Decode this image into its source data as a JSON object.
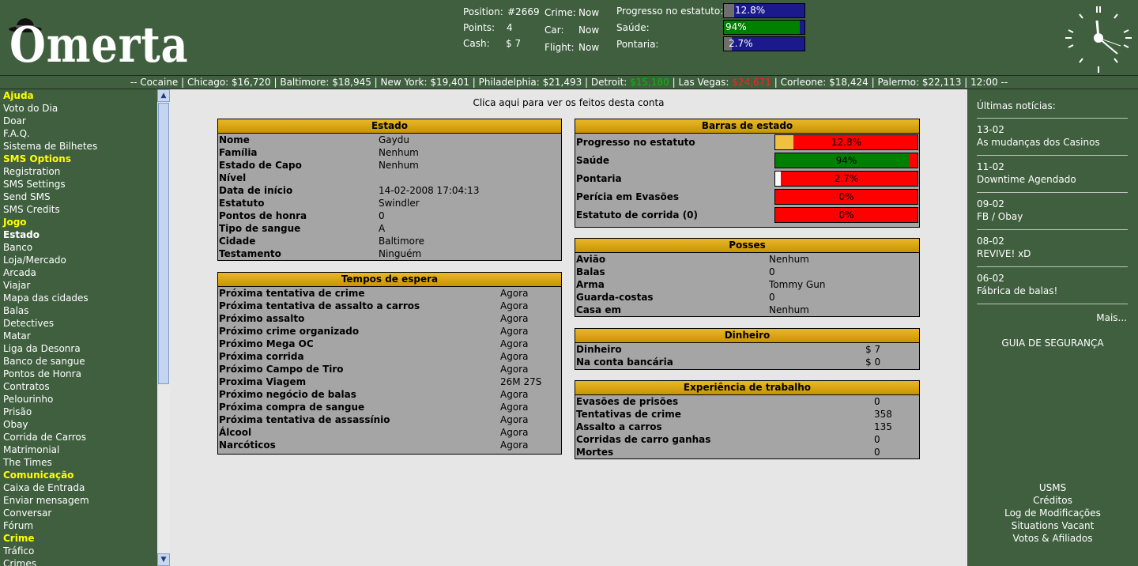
{
  "header": {
    "logo_text": "Omerta",
    "position_label": "Position:",
    "position_value": "#2669",
    "points_label": "Points:",
    "points_value": "4",
    "cash_label": "Cash:",
    "cash_value": "$ 7",
    "crime_label": "Crime:",
    "crime_value": "Now",
    "car_label": "Car:",
    "car_value": "Now",
    "flight_label": "Flight:",
    "flight_value": "Now",
    "progress_label": "Progresso no estatuto:",
    "progress_text": "12.8%",
    "progress_fraction": 0.128,
    "health_label": "Saúde:",
    "health_text": "94%",
    "health_fraction": 0.94,
    "aim_label": "Pontaria:",
    "aim_text": "2.7%",
    "aim_fraction": 0.027,
    "clock_icon": "clock-icon"
  },
  "ticker": {
    "prefix": "-- Cocaine | Chicago: $16,720 | Baltimore: $18,945 | New York: $19,401 | Philadelphia: $21,493 | Detroit: ",
    "detroit": "$15,180",
    "middle": " | Las Vegas: ",
    "vegas": "$24,671",
    "suffix": " | Corleone: $18,424 | Palermo: $22,113 | 12:00 --"
  },
  "sidebar": {
    "items": [
      {
        "label": "Ajuda",
        "type": "cat"
      },
      {
        "label": "Voto do Dia",
        "type": "link"
      },
      {
        "label": "Doar",
        "type": "link"
      },
      {
        "label": "F.A.Q.",
        "type": "link"
      },
      {
        "label": "Sistema de Bilhetes",
        "type": "link"
      },
      {
        "label": "SMS Options",
        "type": "cat"
      },
      {
        "label": "Registration",
        "type": "link"
      },
      {
        "label": "SMS Settings",
        "type": "link"
      },
      {
        "label": "Send SMS",
        "type": "link"
      },
      {
        "label": "SMS Credits",
        "type": "link"
      },
      {
        "label": "Jogo",
        "type": "cat"
      },
      {
        "label": "Estado",
        "type": "current"
      },
      {
        "label": "Banco",
        "type": "link"
      },
      {
        "label": "Loja/Mercado",
        "type": "link"
      },
      {
        "label": "Arcada",
        "type": "link"
      },
      {
        "label": "Viajar",
        "type": "link"
      },
      {
        "label": "Mapa das cidades",
        "type": "link"
      },
      {
        "label": "Balas",
        "type": "link"
      },
      {
        "label": "Detectives",
        "type": "link"
      },
      {
        "label": "Matar",
        "type": "link"
      },
      {
        "label": "Liga da Desonra",
        "type": "link"
      },
      {
        "label": "Banco de sangue",
        "type": "link"
      },
      {
        "label": "Pontos de Honra",
        "type": "link"
      },
      {
        "label": "Contratos",
        "type": "link"
      },
      {
        "label": "Pelourinho",
        "type": "link"
      },
      {
        "label": "Prisão",
        "type": "link"
      },
      {
        "label": "Obay",
        "type": "link"
      },
      {
        "label": "Corrida de Carros",
        "type": "link"
      },
      {
        "label": "Matrimonial",
        "type": "link"
      },
      {
        "label": "The Times",
        "type": "link"
      },
      {
        "label": "Comunicação",
        "type": "cat"
      },
      {
        "label": "Caixa de Entrada",
        "type": "link"
      },
      {
        "label": "Enviar mensagem",
        "type": "link"
      },
      {
        "label": "Conversar",
        "type": "link"
      },
      {
        "label": "Fórum",
        "type": "link"
      },
      {
        "label": "Crime",
        "type": "cat"
      },
      {
        "label": "Tráfico",
        "type": "link"
      },
      {
        "label": "Crimes",
        "type": "link"
      }
    ]
  },
  "main": {
    "top_link": "Clica aqui para ver os feitos desta conta",
    "estado": {
      "title": "Estado",
      "rows": [
        {
          "label": "Nome",
          "value": "Gaydu"
        },
        {
          "label": "Família",
          "value": "Nenhum"
        },
        {
          "label": "Estado de Capo",
          "value": "Nenhum"
        },
        {
          "label": "Nível",
          "value": ""
        },
        {
          "label": "Data de início",
          "value": "14-02-2008 17:04:13"
        },
        {
          "label": "Estatuto",
          "value": "Swindler"
        },
        {
          "label": "Pontos de honra",
          "value": "0"
        },
        {
          "label": "Tipo de sangue",
          "value": "A"
        },
        {
          "label": "Cidade",
          "value": "Baltimore"
        },
        {
          "label": "Testamento",
          "value": "Ninguém"
        }
      ]
    },
    "tempos": {
      "title": "Tempos de espera",
      "rows": [
        {
          "label": "Próxima tentativa de crime",
          "value": "Agora"
        },
        {
          "label": "Próxima tentativa de assalto a carros",
          "value": "Agora"
        },
        {
          "label": "Próximo assalto",
          "value": "Agora"
        },
        {
          "label": "Próximo crime organizado",
          "value": "Agora"
        },
        {
          "label": "Próximo Mega OC",
          "value": "Agora"
        },
        {
          "label": "Próxima corrida",
          "value": "Agora"
        },
        {
          "label": "Próximo Campo de Tiro",
          "value": "Agora"
        },
        {
          "label": "Proxima Viagem",
          "value": "26M 27S"
        },
        {
          "label": "Próximo negócio de balas",
          "value": "Agora"
        },
        {
          "label": "Próxima compra de sangue",
          "value": "Agora"
        },
        {
          "label": "Próxima tentativa de assassínio",
          "value": "Agora"
        },
        {
          "label": "Álcool",
          "value": "Agora"
        },
        {
          "label": "Narcóticos",
          "value": "Agora"
        }
      ]
    },
    "barras": {
      "title": "Barras de estado",
      "rows": [
        {
          "label": "Progresso no estatuto",
          "text": "12.8%",
          "fraction": 0.128,
          "color": "#f0c040"
        },
        {
          "label": "Saúde",
          "text": "94%",
          "fraction": 0.94,
          "color": "#008000"
        },
        {
          "label": "Pontaria",
          "text": "2.7%",
          "fraction": 0.027,
          "color": "#ffffff"
        },
        {
          "label": "Perícia em Evasões",
          "text": "0%",
          "fraction": 0,
          "color": "#ffffff"
        },
        {
          "label": "Estatuto de corrida (0)",
          "text": "0%",
          "fraction": 0,
          "color": "#ffffff"
        }
      ]
    },
    "posses": {
      "title": "Posses",
      "rows": [
        {
          "label": "Avião",
          "value": "Nenhum"
        },
        {
          "label": "Balas",
          "value": "0"
        },
        {
          "label": "Arma",
          "value": "Tommy Gun"
        },
        {
          "label": "Guarda-costas",
          "value": "0"
        },
        {
          "label": "Casa em",
          "value": "Nenhum"
        }
      ]
    },
    "dinheiro": {
      "title": "Dinheiro",
      "rows": [
        {
          "label": "Dinheiro",
          "value": "$ 7"
        },
        {
          "label": "Na conta bancária",
          "value": "$ 0"
        }
      ]
    },
    "experiencia": {
      "title": "Experiência de trabalho",
      "rows": [
        {
          "label": "Evasões de prisões",
          "value": "0"
        },
        {
          "label": "Tentativas de crime",
          "value": "358"
        },
        {
          "label": "Assalto a carros",
          "value": "135"
        },
        {
          "label": "Corridas de carro ganhas",
          "value": "0"
        },
        {
          "label": "Mortes",
          "value": "0"
        }
      ]
    }
  },
  "news": {
    "title": "Últimas notícias:",
    "items": [
      {
        "date": "13-02",
        "text": "As mudanças dos Casinos"
      },
      {
        "date": "11-02",
        "text": "Downtime Agendado"
      },
      {
        "date": "09-02",
        "text": "FB / Obay"
      },
      {
        "date": "08-02",
        "text": "REVIVE! xD"
      },
      {
        "date": "06-02",
        "text": "Fábrica de balas!"
      }
    ],
    "more": "Mais...",
    "guia": "GUIA DE SEGURANÇA",
    "footer": [
      "USMS",
      "Créditos",
      "Log de Modificações",
      "Situations Vacant",
      "Votos & Afiliados"
    ]
  }
}
